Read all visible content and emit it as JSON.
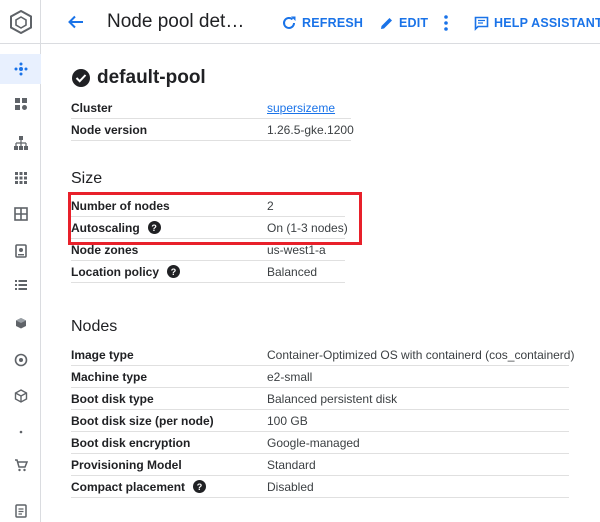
{
  "header": {
    "title": "Node pool det…",
    "refresh_label": "REFRESH",
    "edit_label": "EDIT",
    "help_label": "HELP ASSISTANT"
  },
  "pool": {
    "name": "default-pool",
    "status": "ok"
  },
  "details": [
    {
      "key": "Cluster",
      "value": "supersizeme",
      "link": true
    },
    {
      "key": "Node version",
      "value": "1.26.5-gke.1200"
    }
  ],
  "size": {
    "title": "Size",
    "rows": [
      {
        "key": "Number of nodes",
        "value": "2"
      },
      {
        "key": "Autoscaling",
        "value": "On (1-3 nodes)",
        "help": true
      },
      {
        "key": "Node zones",
        "value": "us-west1-a"
      },
      {
        "key": "Location policy",
        "value": "Balanced",
        "help": true
      }
    ]
  },
  "nodes": {
    "title": "Nodes",
    "rows": [
      {
        "key": "Image type",
        "value": "Container-Optimized OS with containerd (cos_containerd)"
      },
      {
        "key": "Machine type",
        "value": "e2-small"
      },
      {
        "key": "Boot disk type",
        "value": "Balanced persistent disk"
      },
      {
        "key": "Boot disk size (per node)",
        "value": "100 GB"
      },
      {
        "key": "Boot disk encryption",
        "value": "Google-managed"
      },
      {
        "key": "Provisioning Model",
        "value": "Standard"
      },
      {
        "key": "Compact placement",
        "value": "Disabled",
        "help": true
      }
    ]
  },
  "help_glyph": "?",
  "colors": {
    "accent": "#1a73e8",
    "highlight": "#e8202a"
  }
}
